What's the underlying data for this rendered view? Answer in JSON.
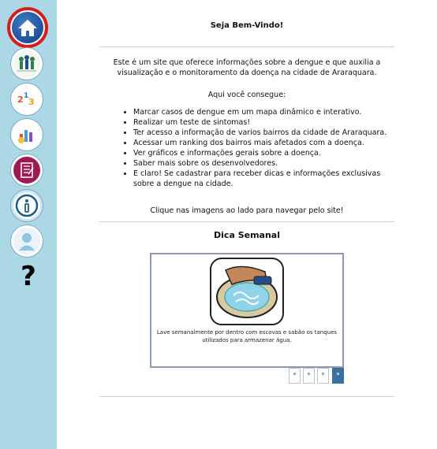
{
  "nav": {
    "help_glyph": "?",
    "icons": [
      "home-icon",
      "people-icon",
      "numbers-icon",
      "charts-icon",
      "test-icon",
      "info-icon",
      "user-icon",
      "help-icon"
    ]
  },
  "main": {
    "welcome": "Seja Bem-Vindo!",
    "intro": "Este é um site que oferece informações sobre a dengue e que auxilia a visualização e o monitoramento da doença na cidade de Araraquara.",
    "can_do": "Aqui você consegue:",
    "features": [
      "Marcar casos de dengue em um mapa dinâmico e interativo.",
      "Realizar um teste de sintomas!",
      "Ter acesso a informação de varios bairros da cidade de Araraquara.",
      "Acessar um ranking dos bairros mais afetados com a doença.",
      "Ver gráficos e informações gerais sobre a doença.",
      "Saber mais sobre os desenvolvedores.",
      "E claro! Se cadastrar para receber dicas e informações exclusivas sobre a dengue na cidade."
    ],
    "click_hint": "Clique nas imagens ao lado para navegar pelo site!"
  },
  "tip": {
    "title": "Dica Semanal",
    "caption": "Lave semanalmente por dentro com escovas e sabão os tanques utilizados para armazenar água.",
    "pagers": [
      "*",
      "*",
      "*",
      "*"
    ],
    "active_index": 3
  },
  "colors": {
    "sidebar": "#acd8e6",
    "home_ring": "#d81b1b",
    "pager_active": "#3b6fa1"
  }
}
